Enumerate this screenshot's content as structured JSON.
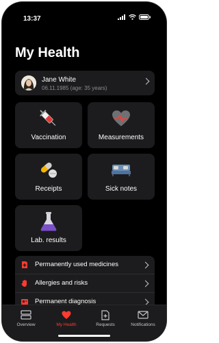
{
  "status_bar": {
    "time": "13:37"
  },
  "page": {
    "title": "My Health"
  },
  "profile": {
    "name": "Jane White",
    "details": "06.11.1985 (age: 35 years)"
  },
  "tiles": [
    {
      "label": "Vaccination",
      "icon": "syringe-icon"
    },
    {
      "label": "Measurements",
      "icon": "heart-pulse-icon"
    },
    {
      "label": "Receipts",
      "icon": "pills-icon"
    },
    {
      "label": "Sick notes",
      "icon": "bed-icon"
    },
    {
      "label": "Lab. results",
      "icon": "flask-icon"
    }
  ],
  "list": [
    {
      "label": "Permanently used medicines",
      "icon": "medicine-icon"
    },
    {
      "label": "Allergies and risks",
      "icon": "hand-icon"
    },
    {
      "label": "Permanent diagnosis",
      "icon": "diagnosis-icon"
    }
  ],
  "tabbar": [
    {
      "label": "Overview",
      "icon": "overview-icon",
      "active": false
    },
    {
      "label": "My Health",
      "icon": "heart-icon",
      "active": true
    },
    {
      "label": "Requests",
      "icon": "requests-icon",
      "active": false
    },
    {
      "label": "Notifications",
      "icon": "mail-icon",
      "active": false
    }
  ],
  "colors": {
    "accent": "#ff3b30",
    "card": "#1c1c1e",
    "background": "#000000"
  }
}
